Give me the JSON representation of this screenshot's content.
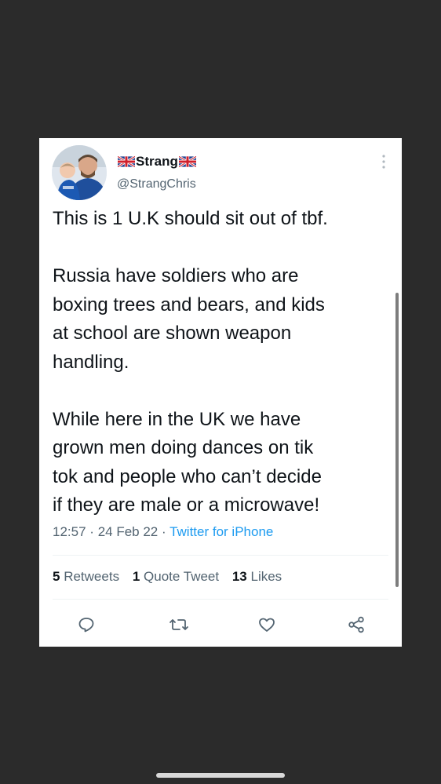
{
  "tweet": {
    "display_name": "Strang",
    "handle": "@StrangChris",
    "paragraphs": [
      "This is 1 U.K should sit out of tbf.",
      "Russia have soldiers who are\nboxing trees and bears, and kids\nat school are shown weapon\nhandling.",
      "While here in the UK we have\ngrown men doing dances on tik\ntok and people who can’t decide\nif they are male or a microwave!"
    ],
    "time": "12:57",
    "date": "24 Feb 22",
    "separator": "·",
    "source": "Twitter for iPhone"
  },
  "stats": {
    "retweets_count": "5",
    "retweets_label": "Retweets",
    "quotes_count": "1",
    "quotes_label": "Quote Tweet",
    "likes_count": "13",
    "likes_label": "Likes"
  },
  "actions": {
    "icons": [
      "reply-icon",
      "retweet-icon",
      "like-icon",
      "share-icon"
    ]
  },
  "colors": {
    "background": "#2b2b2b",
    "card": "#ffffff",
    "text": "#0f1419",
    "secondary_text": "#536471",
    "link": "#1d9bf0"
  }
}
